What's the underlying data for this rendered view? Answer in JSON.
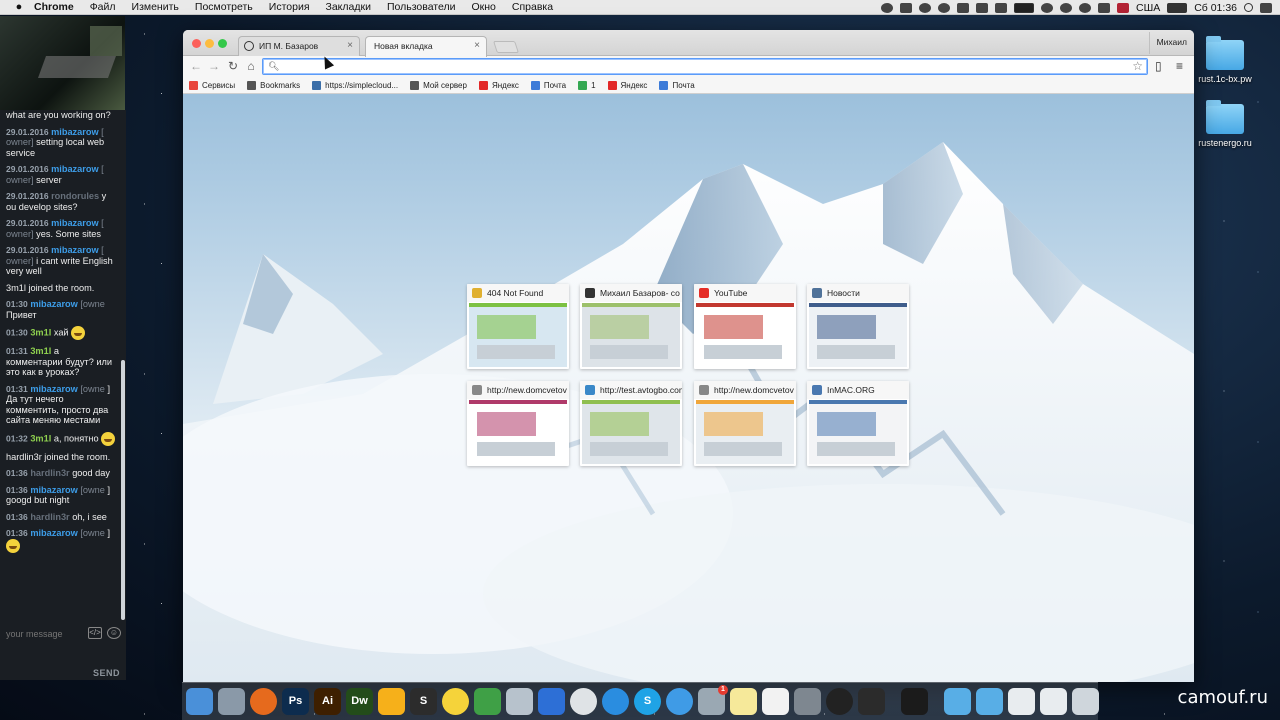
{
  "menubar": {
    "app_name": "Chrome",
    "items": [
      "Файл",
      "Изменить",
      "Посмотреть",
      "История",
      "Закладки",
      "Пользователи",
      "Окно",
      "Справка"
    ],
    "input_source": "США",
    "clock": "Сб 01:36"
  },
  "chat": {
    "messages": [
      {
        "ts": "",
        "user": "",
        "user_class": "",
        "role": "",
        "text": "what are you working on?"
      },
      {
        "ts": "29.01.2016",
        "user": "mibazarow",
        "user_class": "blue",
        "role": "[ owner]",
        "text": "setting local web service"
      },
      {
        "ts": "29.01.2016",
        "user": "mibazarow",
        "user_class": "blue",
        "role": "[ owner]",
        "text": "server"
      },
      {
        "ts": "29.01.2016",
        "user": "rondorules",
        "user_class": "gray",
        "role": "",
        "text": "y ou develop sites?"
      },
      {
        "ts": "29.01.2016",
        "user": "mibazarow",
        "user_class": "blue",
        "role": "[ owner]",
        "text": "yes. Some sites"
      },
      {
        "ts": "29.01.2016",
        "user": "mibazarow",
        "user_class": "blue",
        "role": "[ owner]",
        "text": "i cant write English very well"
      },
      {
        "ts": "",
        "user": "",
        "user_class": "",
        "role": "",
        "text": "3m1l joined the room."
      },
      {
        "ts": "01:30",
        "user": "mibazarow",
        "user_class": "blue",
        "role": "[owne",
        "text": "Привет"
      },
      {
        "ts": "01:30",
        "user": "3m1l",
        "user_class": "green",
        "role": "",
        "text": "хай"
      },
      {
        "ts": "01:31",
        "user": "3m1l",
        "user_class": "green",
        "role": "",
        "text": "а комментарии будут? или это как в уроках?"
      },
      {
        "ts": "01:31",
        "user": "mibazarow",
        "user_class": "blue",
        "role": "[owne",
        "text": "] Да тут нечего комментить, просто два сайта меняю местами"
      },
      {
        "ts": "01:32",
        "user": "3m1l",
        "user_class": "green",
        "role": "",
        "text": "а, понятно"
      },
      {
        "ts": "",
        "user": "",
        "user_class": "",
        "role": "",
        "text": "hardlin3r joined the room."
      },
      {
        "ts": "01:36",
        "user": "hardlin3r",
        "user_class": "gray",
        "role": "",
        "text": "good day"
      },
      {
        "ts": "01:36",
        "user": "mibazarow",
        "user_class": "blue",
        "role": "[owne",
        "text": "] googd but night"
      },
      {
        "ts": "01:36",
        "user": "hardlin3r",
        "user_class": "gray",
        "role": "",
        "text": "oh, i see"
      },
      {
        "ts": "01:36",
        "user": "mibazarow",
        "user_class": "blue",
        "role": "[owne",
        "text": "]"
      }
    ],
    "input_placeholder": "your message",
    "send_label": "SEND"
  },
  "desktop_icons": [
    {
      "label": "rust.1c-bx.pw"
    },
    {
      "label": "rustenergo.ru"
    }
  ],
  "browser": {
    "tabs": [
      {
        "title": "ИП М. Базаров"
      },
      {
        "title": "Новая вкладка"
      }
    ],
    "profile_name": "Михаил",
    "address_value": "",
    "bookmarks": [
      {
        "label": "Сервисы",
        "color": "#e8453c"
      },
      {
        "label": "Bookmarks",
        "color": "#555555"
      },
      {
        "label": "https://simplecloud...",
        "color": "#3b6ea8"
      },
      {
        "label": "Мой сервер",
        "color": "#555555"
      },
      {
        "label": "Яндекс",
        "color": "#e22828"
      },
      {
        "label": "Почта",
        "color": "#3d7bd8"
      },
      {
        "label": "1",
        "color": "#35a853"
      },
      {
        "label": "Яндекс",
        "color": "#e22828"
      },
      {
        "label": "Почта",
        "color": "#3d7bd8"
      }
    ],
    "most_visited": [
      {
        "title": "404 Not Found",
        "icon_color": "#e0b030"
      },
      {
        "title": "Михаил Базаров- со",
        "icon_color": "#333333"
      },
      {
        "title": "YouTube",
        "icon_color": "#e52d27"
      },
      {
        "title": "Новости",
        "icon_color": "#507299"
      },
      {
        "title": "http://new.domcvetov",
        "icon_color": "#888888"
      },
      {
        "title": "http://test.avtogbo.com",
        "icon_color": "#3a88c8"
      },
      {
        "title": "http://new.domcvetov",
        "icon_color": "#888888"
      },
      {
        "title": "InMAC.ORG",
        "icon_color": "#4a78b0"
      }
    ]
  },
  "watermark": "camouf.ru",
  "dock_icons": [
    "finder-icon",
    "launchpad-icon",
    "firefox-icon",
    "photoshop-icon",
    "illustrator-icon",
    "dreamweaver-icon",
    "sketch-icon",
    "sublime-icon",
    "emoji-app-icon",
    "leaf-app-icon",
    "xcode-icon",
    "edge-icon",
    "chrome-icon",
    "safari-icon",
    "skype-icon",
    "messages-icon",
    "mail-icon",
    "notes-icon",
    "reminders-icon",
    "settings-icon",
    "obs-icon",
    "camera-icon",
    "terminal-icon"
  ],
  "dock_badge": "1"
}
